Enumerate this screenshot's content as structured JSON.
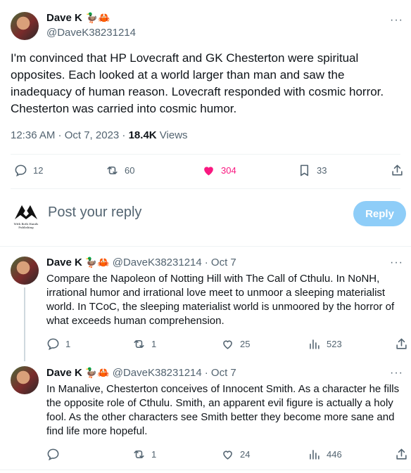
{
  "main_tweet": {
    "author_name": "Dave K",
    "author_emojis": "🦆🦀",
    "author_handle": "@DaveK38231214",
    "text": "I'm convinced that HP Lovecraft and GK Chesterton were spiritual opposites. Each looked at a world larger than man and saw the inadequacy of human reason. Lovecraft responded with cosmic horror. Chesterton was carried into cosmic humor.",
    "time": "12:36 AM · Oct 7, 2023 · ",
    "views_count": "18.4K",
    "views_label": " Views",
    "replies": "12",
    "retweets": "60",
    "likes": "304",
    "bookmarks": "33",
    "colors": {
      "like": "#f91880",
      "accent": "#1d9bf0"
    }
  },
  "composer": {
    "avatar_caption": "With Both Hands Publishing",
    "placeholder": "Post your reply",
    "button_label": "Reply"
  },
  "replies": [
    {
      "author_name": "Dave K",
      "author_emojis": "🦆🦀",
      "author_handle": "@DaveK38231214",
      "date": "· Oct 7",
      "more": "···",
      "text": "Compare the Napoleon of Notting Hill with The Call of Cthulu. In NoNH, irrational humor and irrational love meet to unmoor a sleeping materialist world. In TCoC, the sleeping materialist world is unmoored by the horror of what exceeds human comprehension.",
      "replies": "1",
      "retweets": "1",
      "likes": "25",
      "views": "523"
    },
    {
      "author_name": "Dave K",
      "author_emojis": "🦆🦀",
      "author_handle": "@DaveK38231214",
      "date": "· Oct 7",
      "more": "···",
      "text": "In Manalive, Chesterton conceives of Innocent Smith. As a character he fills the opposite role of Cthulu. Smith, an apparent evil figure is actually a holy fool. As the other characters see Smith better they become more sane and find life more hopeful.",
      "replies": "",
      "retweets": "1",
      "likes": "24",
      "views": "446"
    }
  ]
}
